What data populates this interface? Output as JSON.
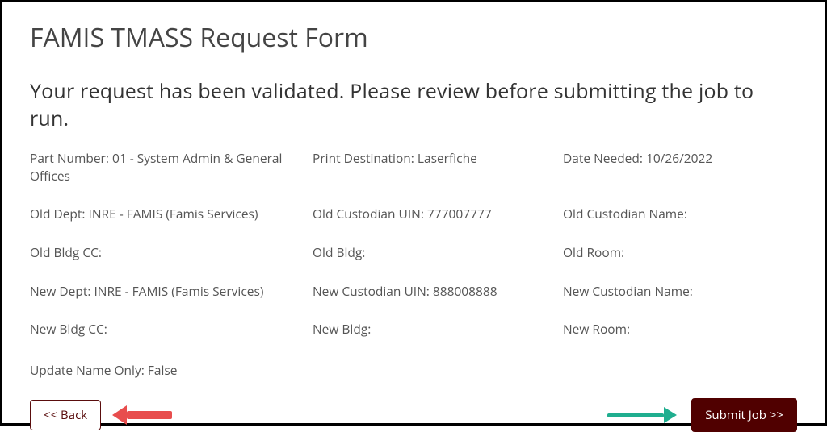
{
  "title": "FAMIS TMASS Request Form",
  "subtitle": "Your request has been validated. Please review before submitting the job to run.",
  "fields": {
    "part_number": "Part Number: 01 - System Admin & General Offices",
    "print_destination": "Print Destination: Laserfiche",
    "date_needed": "Date Needed: 10/26/2022",
    "old_dept": "Old Dept: INRE - FAMIS (Famis Services)",
    "old_custodian_uin": "Old Custodian UIN: 777007777",
    "old_custodian_name": "Old Custodian Name:",
    "old_bldg_cc": "Old Bldg CC:",
    "old_bldg": "Old Bldg:",
    "old_room": "Old Room:",
    "new_dept": "New Dept: INRE - FAMIS (Famis Services)",
    "new_custodian_uin": "New Custodian UIN: 888008888",
    "new_custodian_name": "New Custodian Name:",
    "new_bldg_cc": "New Bldg CC:",
    "new_bldg": "New Bldg:",
    "new_room": "New Room:",
    "update_name_only": "Update Name Only: False"
  },
  "buttons": {
    "back": "<< Back",
    "submit": "Submit Job >>"
  }
}
